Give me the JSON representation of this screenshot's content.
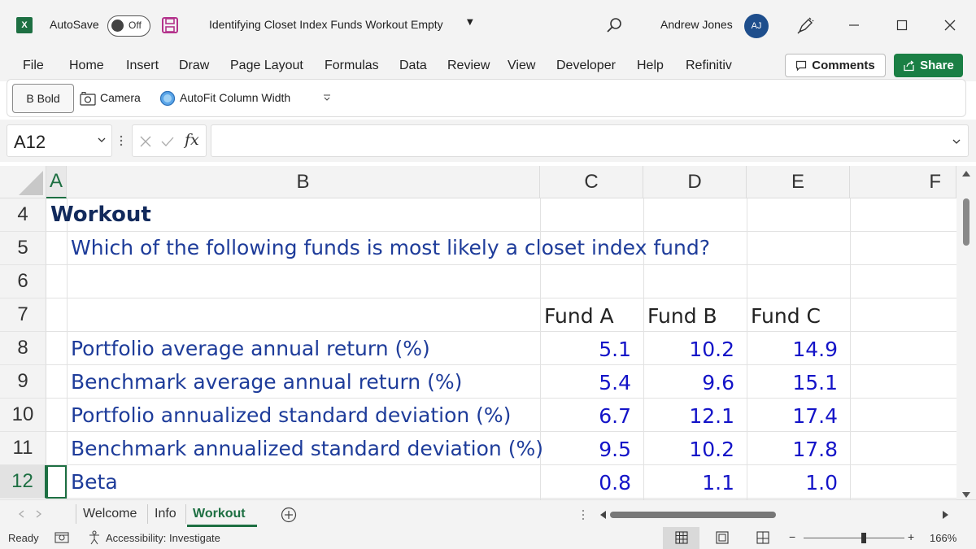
{
  "titlebar": {
    "app_icon": "excel-logo",
    "app_icon_letter": "X",
    "autosave_label": "AutoSave",
    "autosave_state": "Off",
    "doc_title": "Identifying Closet Index Funds Workout Empty",
    "user_name": "Andrew Jones",
    "user_initials": "AJ"
  },
  "menu": {
    "items": [
      "File",
      "Home",
      "Insert",
      "Draw",
      "Page Layout",
      "Formulas",
      "Data",
      "Review",
      "View",
      "Developer",
      "Help",
      "Refinitiv"
    ],
    "comments_label": "Comments",
    "share_label": "Share"
  },
  "quick_access": {
    "bold_label": "B  Bold",
    "camera_label": "Camera",
    "autofit_label": "AutoFit Column Width"
  },
  "formula_bar": {
    "name_box": "A12",
    "fx_label": "fx",
    "formula": ""
  },
  "grid": {
    "columns": [
      "A",
      "B",
      "C",
      "D",
      "E",
      "F"
    ],
    "selected_column": "A",
    "rows": [
      "4",
      "5",
      "6",
      "7",
      "8",
      "9",
      "10",
      "11",
      "12"
    ],
    "selected_row": "12",
    "title": "Workout",
    "question": "Which of the following funds is most likely a closet index fund?",
    "fund_headers": [
      "Fund A",
      "Fund B",
      "Fund C"
    ],
    "metrics": [
      {
        "label": "Portfolio average annual return (%)",
        "values": [
          "5.1",
          "10.2",
          "14.9"
        ]
      },
      {
        "label": "Benchmark average annual return (%)",
        "values": [
          "5.4",
          "9.6",
          "15.1"
        ]
      },
      {
        "label": "Portfolio annualized standard deviation (%)",
        "values": [
          "6.7",
          "12.1",
          "17.4"
        ]
      },
      {
        "label": "Benchmark annualized standard deviation (%)",
        "values": [
          "9.5",
          "10.2",
          "17.8"
        ]
      },
      {
        "label": "Beta",
        "values": [
          "0.8",
          "1.1",
          "1.0"
        ]
      }
    ]
  },
  "sheets": {
    "tabs": [
      "Welcome",
      "Info",
      "Workout"
    ],
    "active": "Workout"
  },
  "status": {
    "ready": "Ready",
    "accessibility": "Accessibility: Investigate",
    "zoom": "166%"
  },
  "colors": {
    "excel_green": "#1d6f42",
    "label_blue": "#1e3c9a",
    "number_blue": "#1414c8",
    "title_navy": "#122a5c"
  }
}
